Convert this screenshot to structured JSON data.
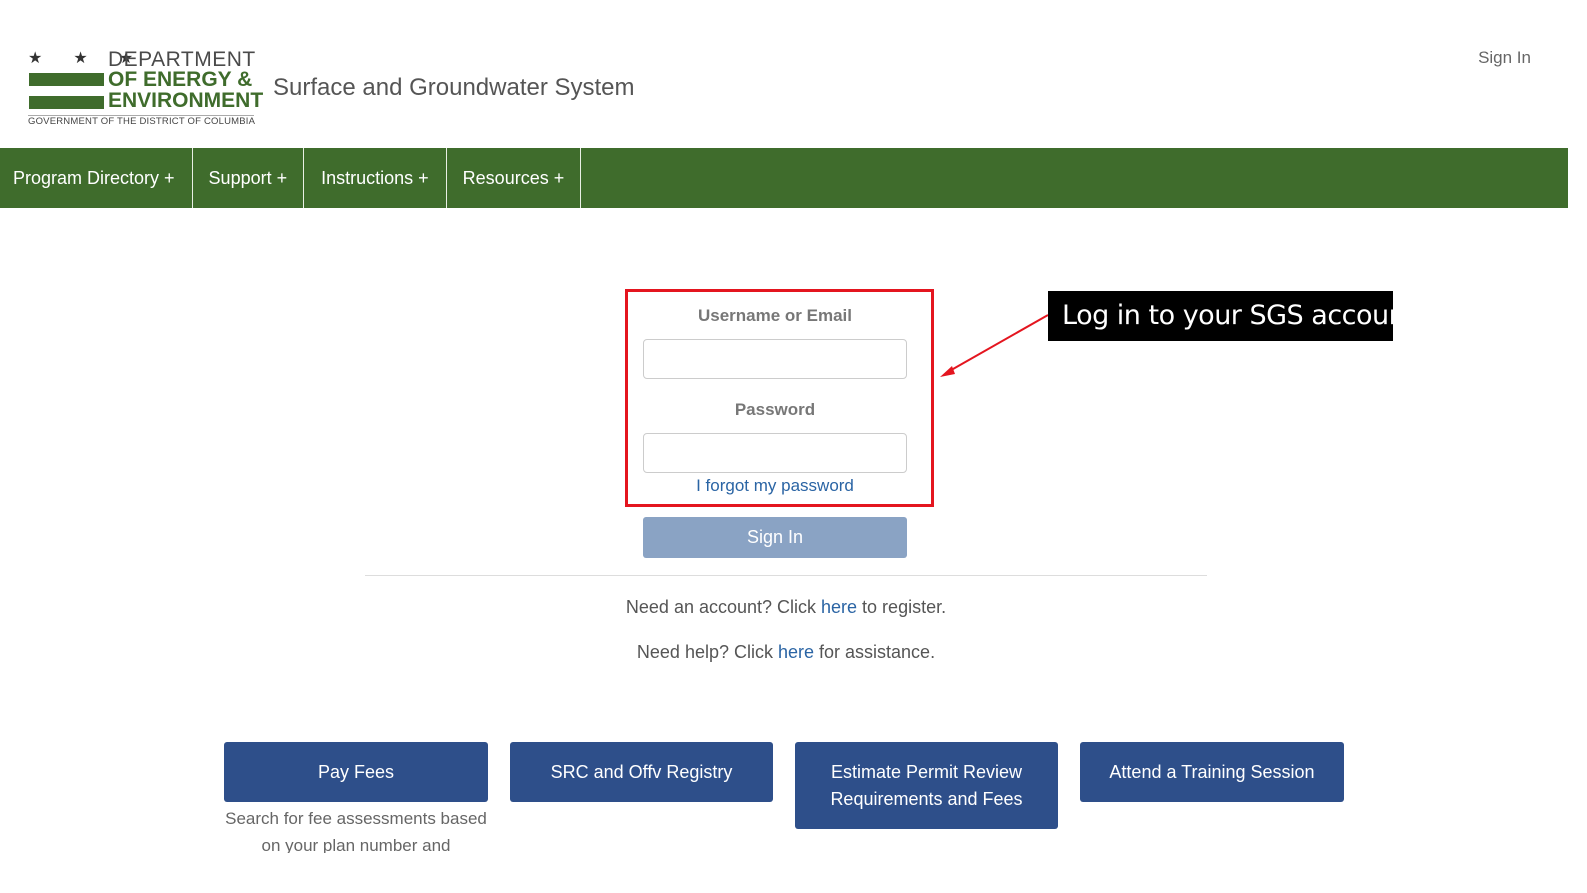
{
  "header": {
    "logo": {
      "stars": "★ ★ ★",
      "line1": "DEPARTMENT",
      "line2": "OF ENERGY &",
      "line3": "ENVIRONMENT",
      "subline": "GOVERNMENT OF THE DISTRICT OF COLUMBIA"
    },
    "site_title": "Surface and Groundwater System",
    "sign_in_link": "Sign In"
  },
  "nav": {
    "items": [
      {
        "label": "Program Directory +"
      },
      {
        "label": "Support +"
      },
      {
        "label": "Instructions +"
      },
      {
        "label": "Resources +"
      }
    ]
  },
  "login": {
    "username_label": "Username or Email",
    "username_value": "",
    "password_label": "Password",
    "password_value": "",
    "forgot_link": "I forgot my password",
    "signin_button": "Sign In"
  },
  "messages": {
    "register_prefix": "Need an account? Click ",
    "register_link": "here",
    "register_suffix": " to register.",
    "help_prefix": "Need help? Click ",
    "help_link": "here",
    "help_suffix": " for assistance."
  },
  "annotation": {
    "callout_text": "Log in to your SGS account",
    "highlight_color": "#e4151f"
  },
  "actions": [
    {
      "label": "Pay Fees"
    },
    {
      "label": "SRC and Offv Registry"
    },
    {
      "label": "Estimate Permit Review Requirements and Fees"
    },
    {
      "label": "Attend a Training Session"
    }
  ],
  "pay_fees_desc": "Search for fee assessments based on your plan number and",
  "colors": {
    "nav_green": "#3f6c2c",
    "button_blue": "#2e4f8a",
    "signin_disabled": "#8aa3c4",
    "link_blue": "#2a64a4"
  }
}
